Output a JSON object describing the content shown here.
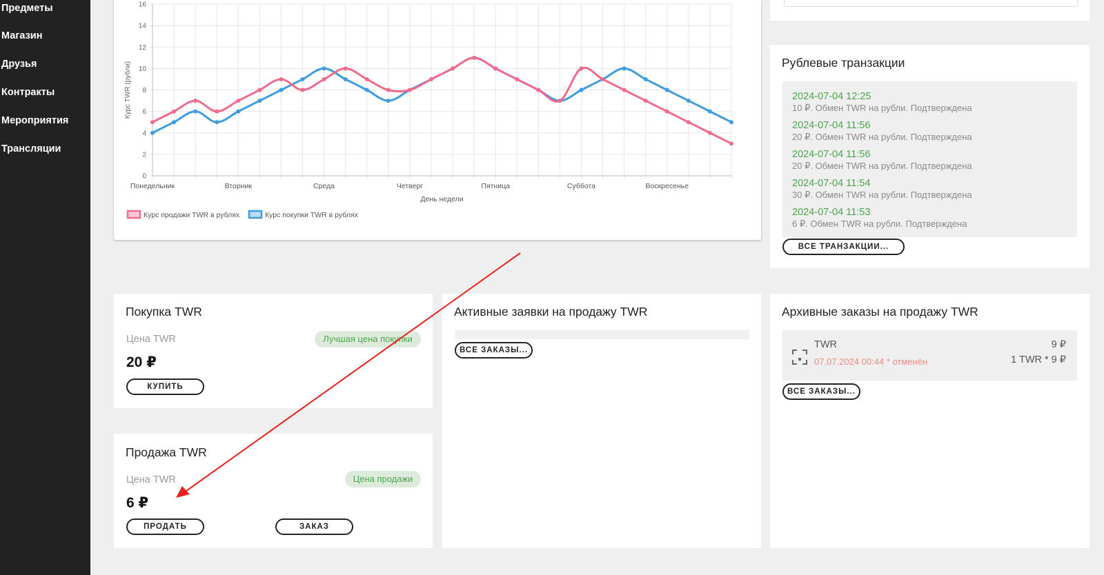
{
  "sidebar": {
    "items": [
      {
        "label": "Предметы"
      },
      {
        "label": "Магазин"
      },
      {
        "label": "Друзья"
      },
      {
        "label": "Контракты"
      },
      {
        "label": "Мероприятия"
      },
      {
        "label": "Трансляции"
      }
    ]
  },
  "chart_data": {
    "type": "line",
    "categories": [
      "Понедельник",
      "Вторник",
      "Среда",
      "Четверг",
      "Пятница",
      "Суббота",
      "Воскресенье"
    ],
    "x": [
      0,
      1,
      2,
      3,
      4,
      5,
      6,
      7,
      8,
      9,
      10,
      11,
      12,
      13,
      14,
      15,
      16,
      17,
      18,
      19,
      20,
      21,
      22,
      23,
      24,
      25,
      26,
      27
    ],
    "series": [
      {
        "name": "Курс продажи TWR в рублях",
        "color": "#f06a8a",
        "values": [
          5,
          6,
          7,
          6,
          7,
          8,
          9,
          8,
          9,
          10,
          9,
          8,
          8,
          9,
          10,
          11,
          10,
          9,
          8,
          7,
          10,
          9,
          8,
          7,
          6,
          5,
          4,
          3
        ]
      },
      {
        "name": "Курс покупки TWR в рублях",
        "color": "#3d9be0",
        "values": [
          4,
          5,
          6,
          5,
          6,
          7,
          8,
          9,
          10,
          9,
          8,
          7,
          8,
          9,
          10,
          11,
          10,
          9,
          8,
          7,
          8,
          9,
          10,
          9,
          8,
          7,
          6,
          5
        ]
      }
    ],
    "xlabel": "День недели",
    "ylabel": "Курс TWR (рубли)",
    "yticks": [
      "0",
      "2",
      "4",
      "6",
      "8",
      "10",
      "12",
      "14",
      "16"
    ],
    "ylim": [
      0,
      16
    ],
    "grid": true,
    "legend_position": "bottom-left"
  },
  "transactions": {
    "title": "Рублевые транзакции",
    "items": [
      {
        "date": "2024-07-04 12:25",
        "desc": "10 ₽. Обмен TWR на рубли. Подтверждена"
      },
      {
        "date": "2024-07-04 11:56",
        "desc": "20 ₽. Обмен TWR на рубли. Подтверждена"
      },
      {
        "date": "2024-07-04 11:56",
        "desc": "20 ₽. Обмен TWR на рубли. Подтверждена"
      },
      {
        "date": "2024-07-04 11:54",
        "desc": "30 ₽. Обмен TWR на рубли. Подтверждена"
      },
      {
        "date": "2024-07-04 11:53",
        "desc": "6 ₽. Обмен TWR на рубли. Подтверждена"
      }
    ],
    "all_button": "ВСЕ ТРАНЗАКЦИИ..."
  },
  "buy": {
    "title": "Покупка TWR",
    "price_label": "Цена TWR",
    "badge": "Лучшая цена покупки",
    "price": "20 ₽",
    "button": "КУПИТЬ"
  },
  "sell": {
    "title": "Продажа TWR",
    "price_label": "Цена TWR",
    "badge": "Цена продажи",
    "price": "6 ₽",
    "sell_button": "ПРОДАТЬ",
    "order_button": "ЗАКАЗ"
  },
  "active_orders": {
    "title": "Активные заявки на продажу TWR",
    "all_button": "ВСЕ ЗАКАЗЫ..."
  },
  "archive_orders": {
    "title": "Архивные заказы на продажу TWR",
    "item": {
      "name": "TWR",
      "date_status": "07.07.2024 00:44 * отменён",
      "price": "9 ₽",
      "qty": "1 TWR * 9 ₽"
    },
    "all_button": "ВСЕ ЗАКАЗЫ..."
  },
  "annotation": {
    "arrow_color": "#e8201e"
  }
}
